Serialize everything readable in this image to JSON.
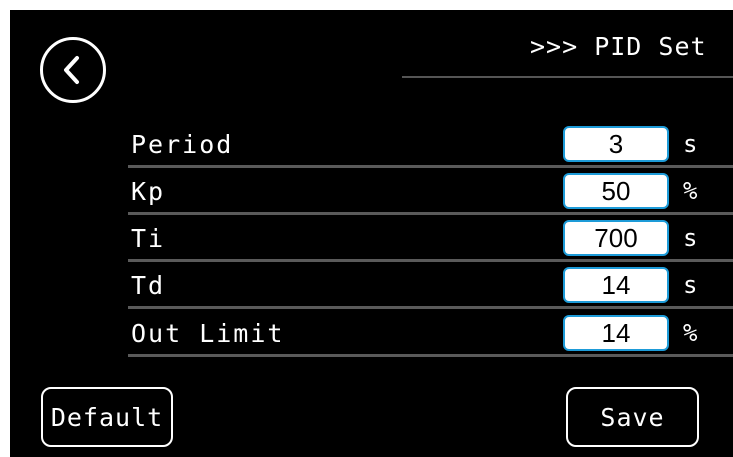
{
  "header": {
    "title": ">>> PID Set",
    "back_icon": "chevron-left-circle-icon"
  },
  "rows": [
    {
      "label": "Period",
      "value": "3",
      "unit": "s"
    },
    {
      "label": "Kp",
      "value": "50",
      "unit": "%"
    },
    {
      "label": "Ti",
      "value": "700",
      "unit": "s"
    },
    {
      "label": "Td",
      "value": "14",
      "unit": "s"
    },
    {
      "label": "Out Limit",
      "value": "14",
      "unit": "%"
    }
  ],
  "buttons": {
    "default_label": "Default",
    "save_label": "Save"
  },
  "colors": {
    "background": "#000000",
    "text": "#ffffff",
    "input_border": "#1d9bd8",
    "divider": "#5a5a5a"
  }
}
